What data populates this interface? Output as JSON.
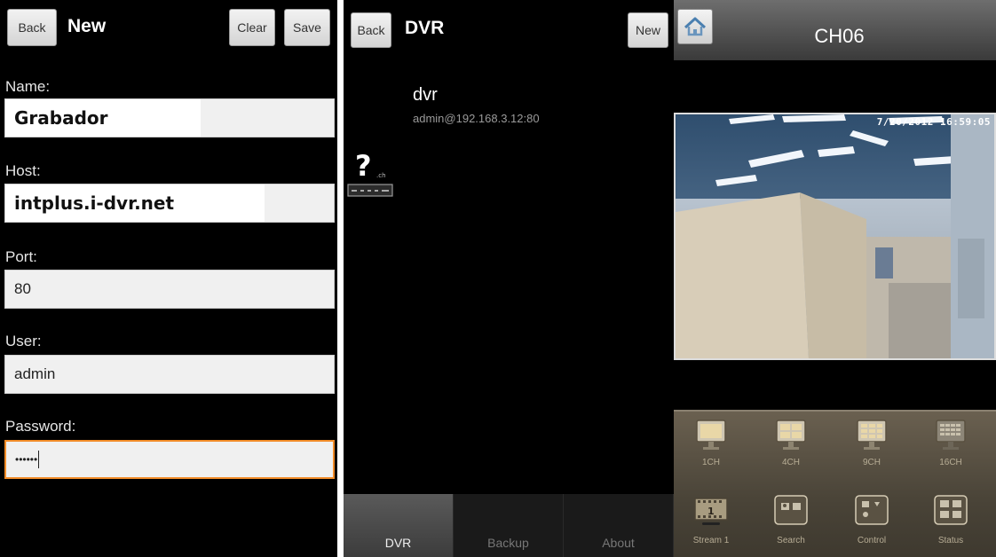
{
  "screen1": {
    "back_label": "Back",
    "title": "New",
    "clear_label": "Clear",
    "save_label": "Save",
    "fields": [
      {
        "label": "Name:",
        "value": "Grabador"
      },
      {
        "label": "Host:",
        "value": "intplus.i-dvr.net"
      },
      {
        "label": "Port:",
        "value": "80"
      },
      {
        "label": "User:",
        "value": "admin"
      },
      {
        "label": "Password:",
        "value": "••••••"
      }
    ],
    "focus_color": "#f28c28"
  },
  "screen2": {
    "back_label": "Back",
    "title": "DVR",
    "new_label": "New",
    "device": {
      "name": "dvr",
      "address": "admin@192.168.3.12:80",
      "icon": "dvr-unknown-icon"
    },
    "tabs": [
      {
        "label": "DVR",
        "active": true
      },
      {
        "label": "Backup",
        "active": false
      },
      {
        "label": "About",
        "active": false
      }
    ]
  },
  "screen3": {
    "title": "CH06",
    "timestamp": "7/20/2012 16:59:05",
    "controls": [
      {
        "label": "1CH",
        "icon": "one-channel-icon"
      },
      {
        "label": "4CH",
        "icon": "four-channel-icon"
      },
      {
        "label": "9CH",
        "icon": "nine-channel-icon"
      },
      {
        "label": "16CH",
        "icon": "sixteen-channel-icon"
      },
      {
        "label": "Stream 1",
        "icon": "film-stream-icon"
      },
      {
        "label": "Search",
        "icon": "search-icon"
      },
      {
        "label": "Control",
        "icon": "control-icon"
      },
      {
        "label": "Status",
        "icon": "status-icon"
      }
    ]
  }
}
